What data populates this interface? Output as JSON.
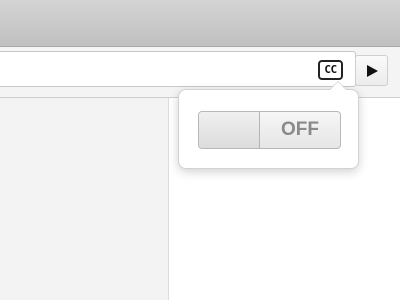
{
  "toolbar": {
    "captions_button_label": "CC"
  },
  "popover": {
    "toggle_state_label": "OFF",
    "toggle_on": false
  },
  "icons": {
    "captions": "closed-captions-icon",
    "play": "play-icon"
  }
}
